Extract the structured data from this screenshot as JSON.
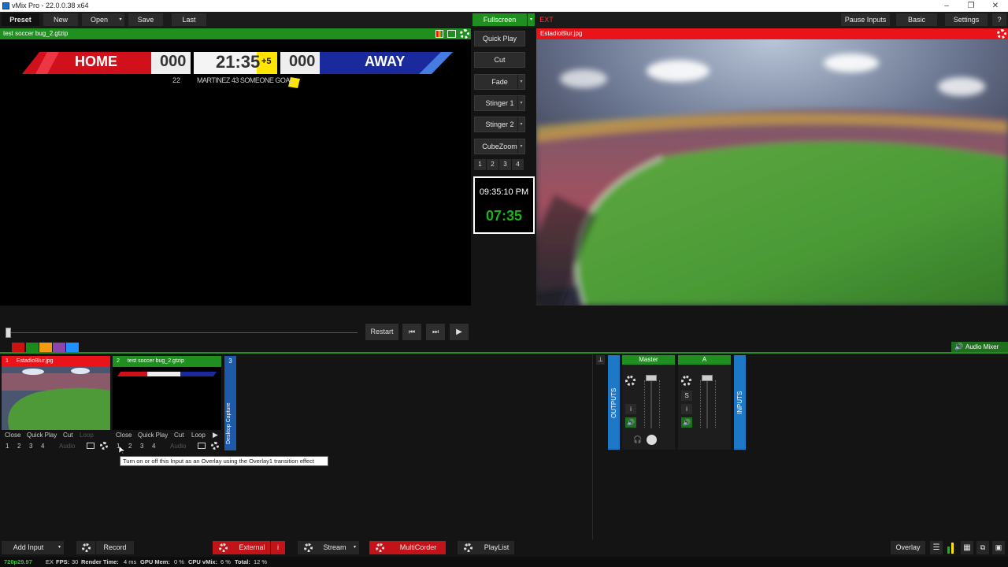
{
  "window": {
    "title": "vMix Pro - 22.0.0.38 x64",
    "minimize": "–",
    "restore": "❐",
    "close": "✕"
  },
  "toolbar": {
    "preset": "Preset",
    "new": "New",
    "open": "Open",
    "save": "Save",
    "last": "Last",
    "fullscreen": "Fullscreen",
    "ext": "EXT",
    "pause_inputs": "Pause Inputs",
    "basic": "Basic",
    "settings": "Settings",
    "help": "?"
  },
  "preview": {
    "title": "test soccer bug_2.gtzip",
    "scorebug": {
      "home": "HOME",
      "home_score": "000",
      "time": "21:35",
      "added": "+5",
      "away_score": "000",
      "away": "AWAY",
      "player_number": "22",
      "goal_text": "MARTINEZ 43 SOMEONE GOAL"
    }
  },
  "program": {
    "title": "EstadioBlur.jpg"
  },
  "transitions": {
    "quick_play": "Quick Play",
    "cut": "Cut",
    "fade": "Fade",
    "stinger1": "Stinger 1",
    "stinger2": "Stinger 2",
    "cubezoom": "CubeZoom",
    "numbers": [
      "1",
      "2",
      "3",
      "4"
    ]
  },
  "clock": {
    "time": "09:35:10 PM",
    "countdown": "07:35"
  },
  "transport": {
    "restart": "Restart"
  },
  "color_tags": [
    "#cc1111",
    "#1a8a1a",
    "#f39c12",
    "#8e44ad",
    "#1e90ff"
  ],
  "audio_mixer_label": "Audio Mixer",
  "inputs": [
    {
      "number": "1",
      "name": "EstadioBlur.jpg",
      "color": "#e8141a",
      "close": "Close",
      "quick_play": "Quick Play",
      "cut": "Cut",
      "loop": "Loop",
      "audio": "Audio",
      "overlays": [
        "1",
        "2",
        "3",
        "4"
      ]
    },
    {
      "number": "2",
      "name": "test soccer bug_2.gtzip",
      "color": "#1f8f1f",
      "close": "Close",
      "quick_play": "Quick Play",
      "cut": "Cut",
      "loop": "Loop",
      "audio": "Audio",
      "overlays": [
        "1",
        "2",
        "3",
        "4"
      ]
    },
    {
      "number": "3",
      "name": "Desktop Capture",
      "color": "#1e5aa8"
    }
  ],
  "tooltip": "Turn on or off this Input as an Overlay using the Overlay1 transition effect",
  "audio": {
    "outputs_label": "OUTPUTS",
    "inputs_label": "INPUTS",
    "master": {
      "name": "Master",
      "i": "i"
    },
    "a": {
      "name": "A",
      "s": "S",
      "i": "i"
    }
  },
  "bottom": {
    "add_input": "Add Input",
    "record": "Record",
    "external": "External",
    "external_i": "i",
    "stream": "Stream",
    "multicorder": "MultiCorder",
    "playlist": "PlayList",
    "overlay": "Overlay"
  },
  "status": {
    "format": "720p29.97",
    "ex": "EX",
    "fps_label": "FPS:",
    "fps": "30",
    "render_label": "Render Time:",
    "render": "4 ms",
    "gpu_label": "GPU Mem:",
    "gpu": "0 %",
    "cpu_label": "CPU vMix:",
    "cpu": "6 %",
    "total_label": "Total:",
    "total": "12 %"
  }
}
